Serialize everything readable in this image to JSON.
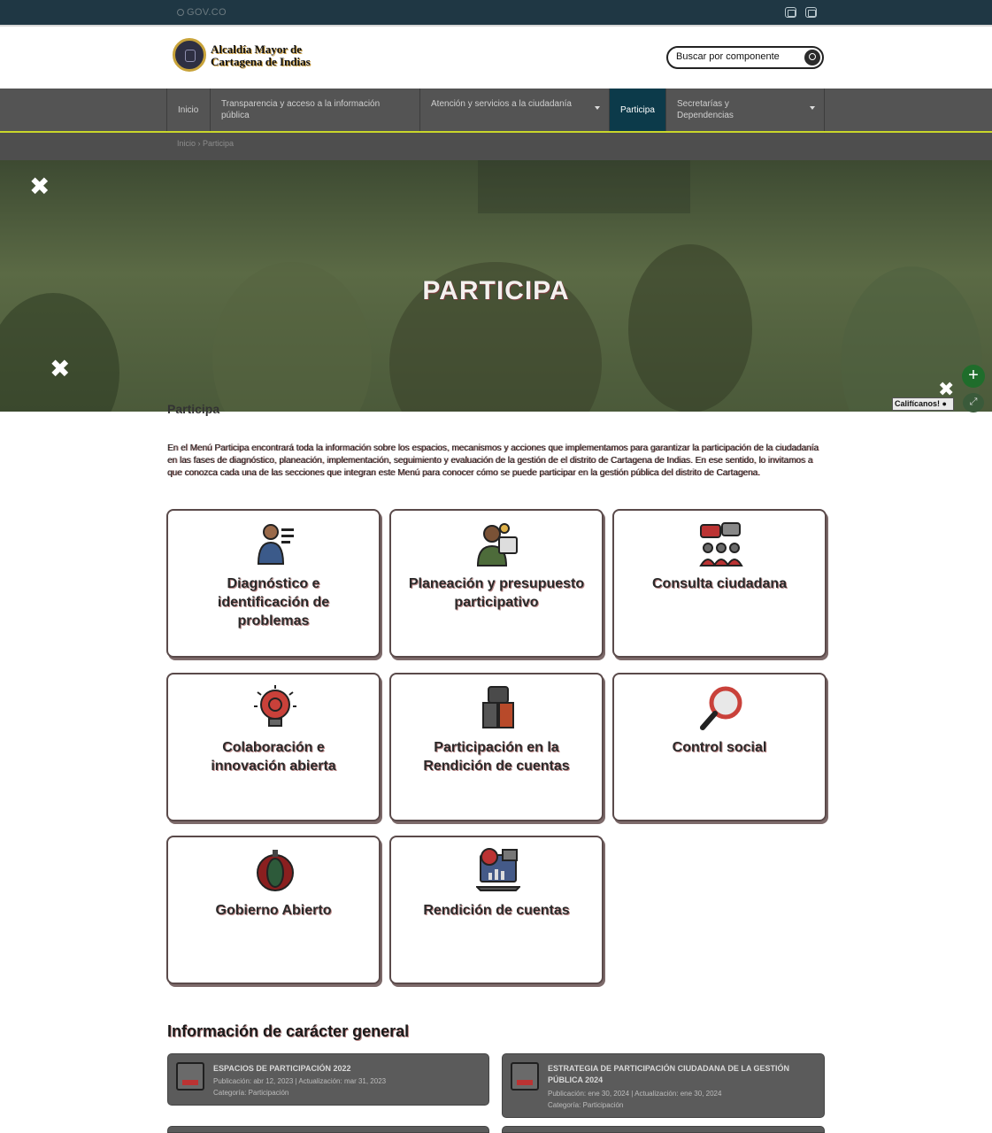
{
  "topbar": {
    "gov_label": "GOV.CO"
  },
  "header": {
    "brand_line1": "Alcaldía Mayor de",
    "brand_line2": "Cartagena de Indias",
    "search_placeholder": "Buscar por componente"
  },
  "nav": {
    "items": [
      "Inicio",
      "Transparencia y acceso a la información pública",
      "Atención y servicios a la ciudadanía",
      "Participa",
      "Secretarías y Dependencias"
    ]
  },
  "breadcrumb": {
    "home": "Inicio",
    "current": "Participa"
  },
  "hero": {
    "title": "PARTICIPA",
    "rate_label": "Califícanos!"
  },
  "section": {
    "title": "Participa",
    "intro": "En el Menú Participa encontrará toda la información sobre los espacios, mecanismos y acciones que implementamos para garantizar la participación de la ciudadanía en las fases de diagnóstico, planeación, implementación, seguimiento y evaluación de la gestión de el distrito de Cartagena de Indias. En ese sentido, lo invitamos a que conozca cada una de las secciones que integran este Menú para conocer cómo se puede participar en la gestión pública del distrito de Cartagena."
  },
  "cards": [
    {
      "label": "Diagnóstico e identificación de problemas",
      "icon": "person-checklist-icon"
    },
    {
      "label": "Planeación y presupuesto participativo",
      "icon": "person-planning-icon"
    },
    {
      "label": "Consulta ciudadana",
      "icon": "people-consultation-icon"
    },
    {
      "label": "Colaboración e innovación abierta",
      "icon": "lightbulb-gear-icon"
    },
    {
      "label": "Participación en la Rendición de cuentas",
      "icon": "people-accountability-icon"
    },
    {
      "label": "Control social",
      "icon": "magnifier-icon"
    },
    {
      "label": "Gobierno Abierto",
      "icon": "open-government-icon"
    },
    {
      "label": "Rendición de cuentas",
      "icon": "laptop-chart-icon"
    }
  ],
  "general_info": {
    "title": "Información de carácter general",
    "docs": [
      {
        "title": "ESPACIOS DE PARTICIPACIÓN 2022",
        "meta1": "Publicación: abr 12, 2023 | Actualización: mar 31, 2023",
        "meta2": "Categoría: Participación"
      },
      {
        "title": "ESTRATEGIA DE PARTICIPACIÓN CIUDADANA DE LA GESTIÓN PÚBLICA 2024",
        "meta1": "Publicación: ene 30, 2024 | Actualización: ene 30, 2024",
        "meta2": "Categoría: Participación"
      }
    ]
  }
}
